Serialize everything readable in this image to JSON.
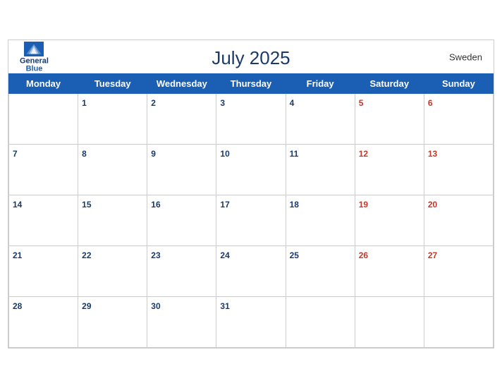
{
  "header": {
    "title": "July 2025",
    "country": "Sweden",
    "logo": {
      "general": "General",
      "blue": "Blue"
    }
  },
  "weekdays": [
    "Monday",
    "Tuesday",
    "Wednesday",
    "Thursday",
    "Friday",
    "Saturday",
    "Sunday"
  ],
  "weeks": [
    [
      null,
      1,
      2,
      3,
      4,
      5,
      6
    ],
    [
      7,
      8,
      9,
      10,
      11,
      12,
      13
    ],
    [
      14,
      15,
      16,
      17,
      18,
      19,
      20
    ],
    [
      21,
      22,
      23,
      24,
      25,
      26,
      27
    ],
    [
      28,
      29,
      30,
      31,
      null,
      null,
      null
    ]
  ]
}
